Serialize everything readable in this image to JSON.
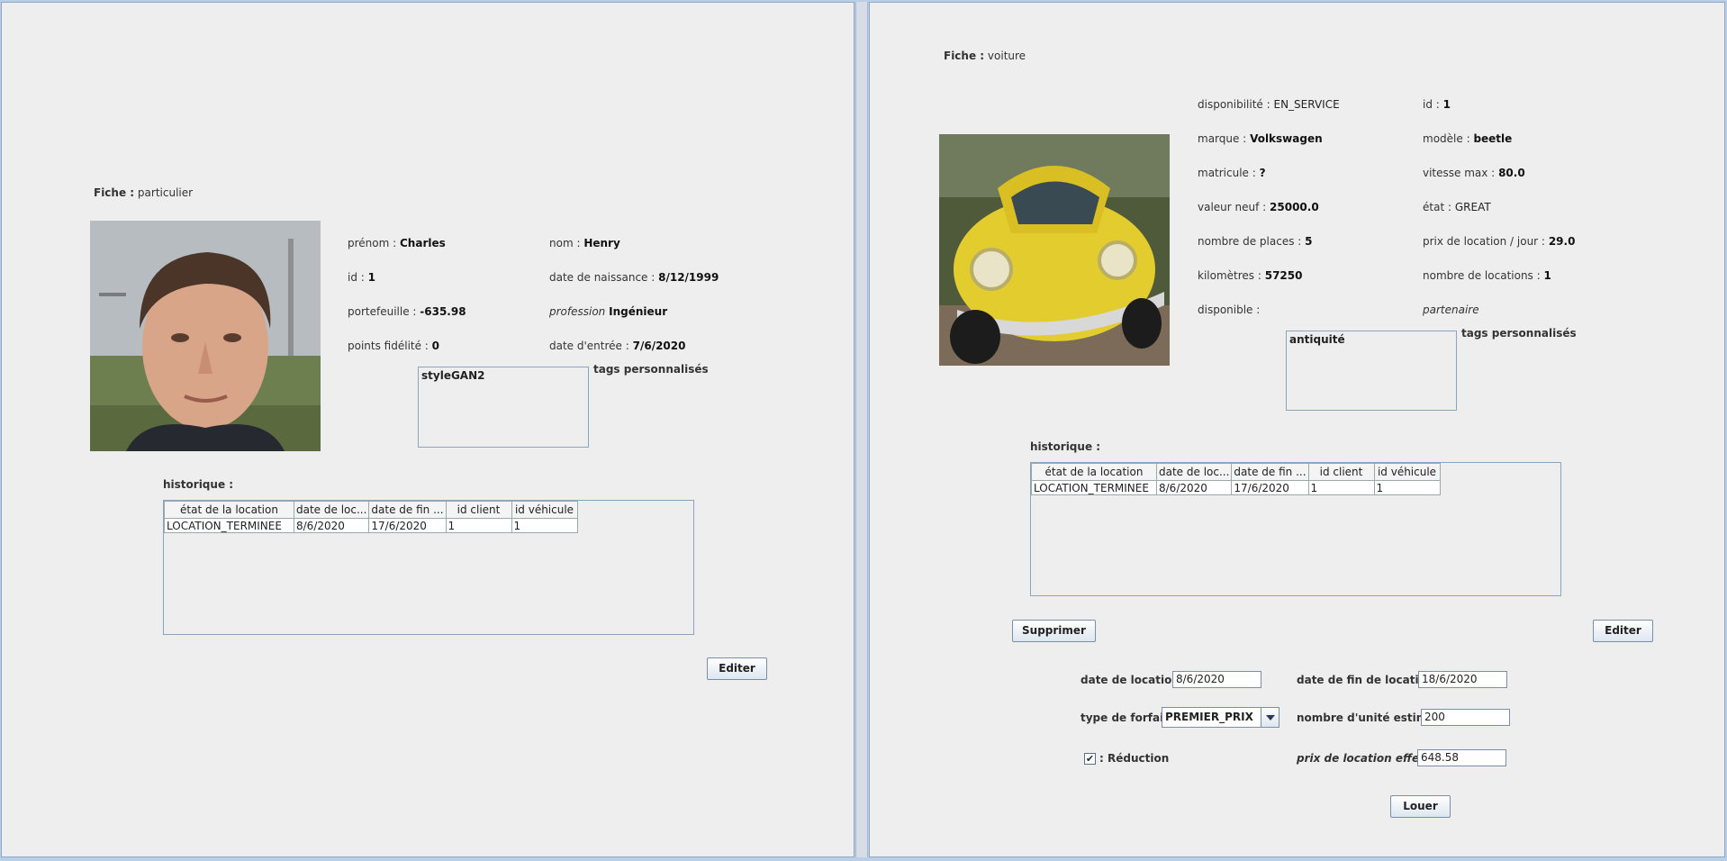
{
  "left": {
    "fiche_label": "Fiche :",
    "fiche_value": "particulier",
    "fields": {
      "prenom": {
        "label": "prénom :",
        "value": "Charles"
      },
      "nom": {
        "label": "nom :",
        "value": "Henry"
      },
      "id": {
        "label": "id :",
        "value": "1"
      },
      "naissance": {
        "label": "date de naissance :",
        "value": "8/12/1999"
      },
      "portefeuille": {
        "label": "portefeuille :",
        "value": "-635.98"
      },
      "profession": {
        "label": "profession",
        "value": "Ingénieur"
      },
      "points": {
        "label": "points fidélité :",
        "value": "0"
      },
      "entree": {
        "label": "date d'entrée :",
        "value": "7/6/2020"
      }
    },
    "tags_label": "tags personnalisés",
    "tags_value": "styleGAN2",
    "historique_label": "historique :",
    "table": {
      "headers": [
        "état de la location",
        "date de loc...",
        "date de fin ...",
        "id client",
        "id véhicule"
      ],
      "rows": [
        [
          "LOCATION_TERMINEE",
          "8/6/2020",
          "17/6/2020",
          "1",
          "1"
        ]
      ]
    },
    "edit_button": "Editer"
  },
  "right": {
    "fiche_label": "Fiche :",
    "fiche_value": "voiture",
    "fields": {
      "disponibilite": {
        "label": "disponibilité :",
        "value": "EN_SERVICE"
      },
      "id": {
        "label": "id :",
        "value": "1"
      },
      "marque": {
        "label": "marque :",
        "value": "Volkswagen"
      },
      "modele": {
        "label": "modèle :",
        "value": "beetle"
      },
      "matricule": {
        "label": "matricule :",
        "value": "?"
      },
      "vitesse": {
        "label": "vitesse max :",
        "value": "80.0"
      },
      "valeur": {
        "label": "valeur neuf :",
        "value": "25000.0"
      },
      "etat": {
        "label": "état :",
        "value": "GREAT"
      },
      "places": {
        "label": "nombre de places :",
        "value": "5"
      },
      "prix_jour": {
        "label": "prix de location / jour :",
        "value": "29.0"
      },
      "km": {
        "label": "kilomètres :",
        "value": "57250"
      },
      "nb_locations": {
        "label": "nombre de locations :",
        "value": "1"
      },
      "disponible": {
        "label": "disponible :",
        "value": ""
      },
      "partenaire": {
        "label": "partenaire",
        "value": ""
      }
    },
    "tags_label": "tags personnalisés",
    "tags_value": "antiquité",
    "historique_label": "historique :",
    "table": {
      "headers": [
        "état de la location",
        "date de loc...",
        "date de fin ...",
        "id client",
        "id véhicule"
      ],
      "rows": [
        [
          "LOCATION_TERMINEE",
          "8/6/2020",
          "17/6/2020",
          "1",
          "1"
        ]
      ]
    },
    "delete_button": "Supprimer",
    "edit_button": "Editer",
    "booking": {
      "date_location_label": "date de location :",
      "date_location_value": "8/6/2020",
      "date_fin_label": "date de fin de location :",
      "date_fin_value": "18/6/2020",
      "forfait_label": "type de forfait :",
      "forfait_value": "PREMIER_PRIX",
      "unite_label": "nombre d'unité estimé :",
      "unite_value": "200",
      "reduction_label": ": Réduction",
      "reduction_checked": true,
      "reduction_mark": "✔",
      "prix_label": "prix de location effectif",
      "prix_value": "648.58",
      "louer_button": "Louer"
    }
  }
}
